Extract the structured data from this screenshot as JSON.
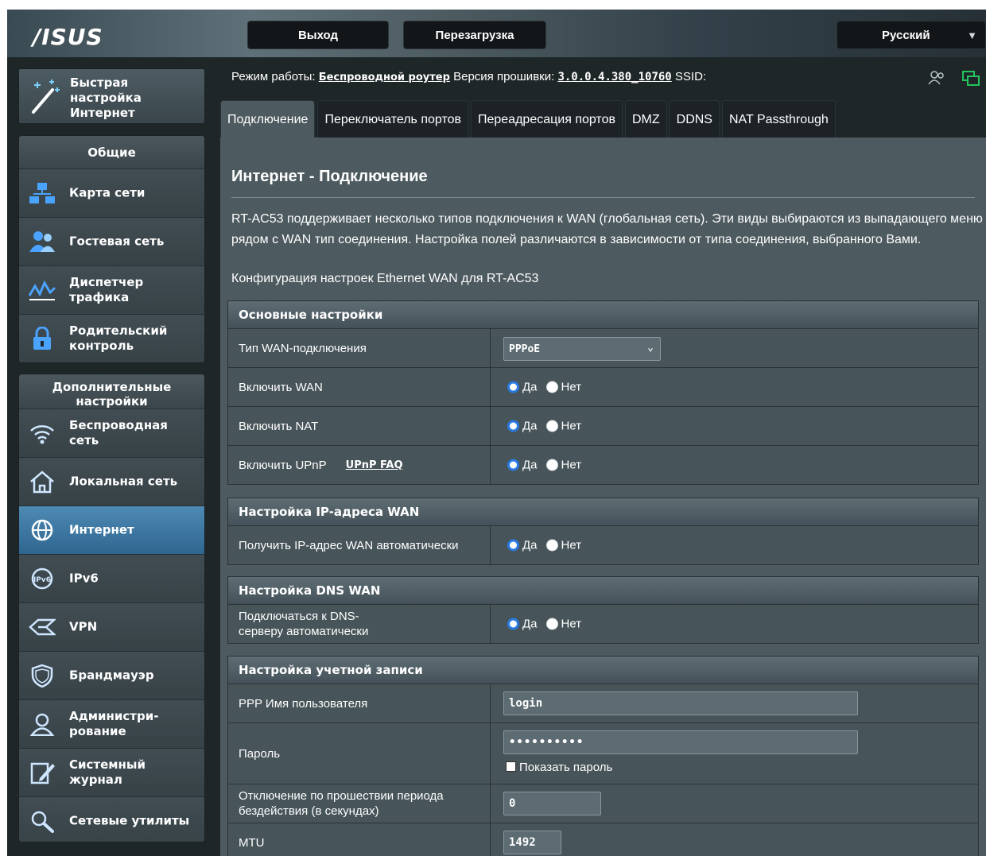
{
  "header": {
    "logo": "/ISUS",
    "logout_label": "Выход",
    "reboot_label": "Перезагрузка",
    "language_label": "Русский"
  },
  "sidebar": {
    "qis_label": "Быстрая настройка Интернет",
    "general": {
      "title": "Общие",
      "items": [
        {
          "label": "Карта сети",
          "icon": "network-map-icon"
        },
        {
          "label": "Гостевая сеть",
          "icon": "guest-network-icon"
        },
        {
          "label": "Диспетчер трафика",
          "icon": "traffic-manager-icon"
        },
        {
          "label": "Родительский контроль",
          "icon": "parental-lock-icon"
        }
      ]
    },
    "advanced": {
      "title": "Дополнительные настройки",
      "items": [
        {
          "label": "Беспроводная сеть",
          "icon": "wifi-icon"
        },
        {
          "label": "Локальная сеть",
          "icon": "home-icon"
        },
        {
          "label": "Интернет",
          "icon": "globe-icon",
          "active": true
        },
        {
          "label": "IPv6",
          "icon": "ipv6-globe-icon"
        },
        {
          "label": "VPN",
          "icon": "vpn-icon"
        },
        {
          "label": "Брандмауэр",
          "icon": "shield-icon"
        },
        {
          "label": "Администри-рование",
          "icon": "admin-user-icon"
        },
        {
          "label": "Системный журнал",
          "icon": "log-edit-icon"
        },
        {
          "label": "Сетевые утилиты",
          "icon": "tools-icon"
        }
      ]
    }
  },
  "status": {
    "mode_label": "Режим работы:",
    "mode_value": "Беспроводной роутер",
    "firmware_label": "Версия прошивки:",
    "firmware_value": "3.0.0.4.380_10760",
    "ssid_label": "SSID:",
    "ssid_value": ""
  },
  "tabs": [
    {
      "label": "Подключение",
      "active": true
    },
    {
      "label": "Переключатель портов"
    },
    {
      "label": "Переадресация портов"
    },
    {
      "label": "DMZ"
    },
    {
      "label": "DDNS"
    },
    {
      "label": "NAT Passthrough"
    }
  ],
  "page": {
    "title": "Интернет - Подключение",
    "description": "RT-AC53 поддерживает несколько типов подключения к WAN (глобальная сеть). Эти виды выбираются из выпадающего меню рядом с WAN тип соединения. Настройка полей различаются в зависимости от типа соединения, выбранного Вами.",
    "config_note": "Конфигурация настроек Ethernet WAN для RT-AC53"
  },
  "radio_labels": {
    "yes": "Да",
    "no": "Нет"
  },
  "sections": {
    "basic": {
      "title": "Основные настройки",
      "wan_type_label": "Тип WAN-подключения",
      "wan_type_value": "PPPoE",
      "enable_wan_label": "Включить WAN",
      "enable_nat_label": "Включить NAT",
      "enable_upnp_label": "Включить UPnP",
      "upnp_faq": "UPnP FAQ"
    },
    "wan_ip": {
      "title": "Настройка IP-адреса WAN",
      "auto_ip_label": "Получить IP-адрес WAN автоматически"
    },
    "wan_dns": {
      "title": "Настройка DNS WAN",
      "auto_dns_label": "Подключаться к DNS-серверу автоматически"
    },
    "account": {
      "title": "Настройка учетной записи",
      "username_label": "PPP Имя пользователя",
      "username_value": "login",
      "password_label": "Пароль",
      "password_value": "••••••••••",
      "show_password_label": "Показать пароль",
      "idle_label": "Отключение по прошествии периода бездействия (в секундах)",
      "idle_value": "0",
      "mtu_label": "MTU",
      "mtu_value": "1492"
    }
  },
  "colors": {
    "accent_blue": "#2a7ae2",
    "active_menu": "#3c78a4",
    "status_green": "#22c55e"
  }
}
